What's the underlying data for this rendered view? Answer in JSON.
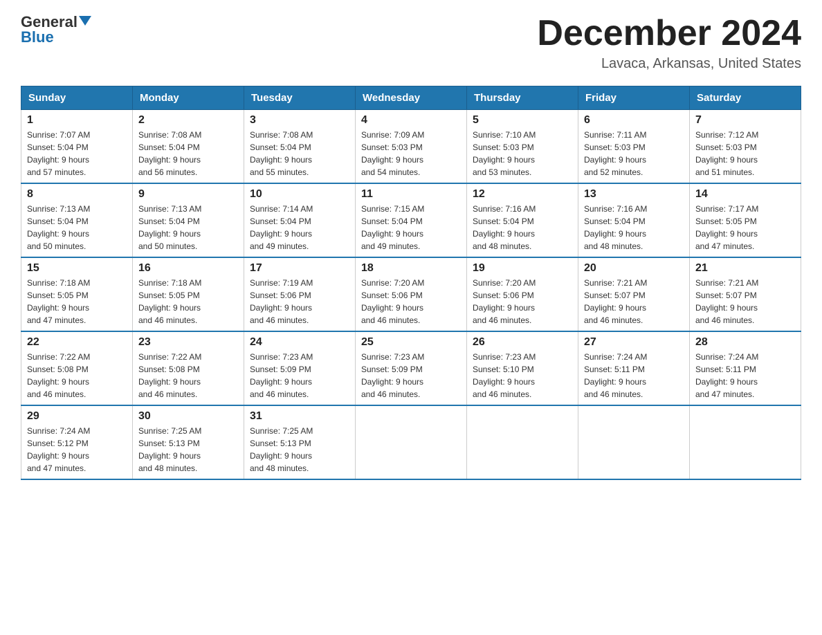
{
  "logo": {
    "name_part1": "General",
    "name_part2": "Blue"
  },
  "header": {
    "title": "December 2024",
    "subtitle": "Lavaca, Arkansas, United States"
  },
  "days_of_week": [
    "Sunday",
    "Monday",
    "Tuesday",
    "Wednesday",
    "Thursday",
    "Friday",
    "Saturday"
  ],
  "weeks": [
    [
      {
        "day": "1",
        "sunrise": "7:07 AM",
        "sunset": "5:04 PM",
        "daylight": "9 hours and 57 minutes."
      },
      {
        "day": "2",
        "sunrise": "7:08 AM",
        "sunset": "5:04 PM",
        "daylight": "9 hours and 56 minutes."
      },
      {
        "day": "3",
        "sunrise": "7:08 AM",
        "sunset": "5:04 PM",
        "daylight": "9 hours and 55 minutes."
      },
      {
        "day": "4",
        "sunrise": "7:09 AM",
        "sunset": "5:03 PM",
        "daylight": "9 hours and 54 minutes."
      },
      {
        "day": "5",
        "sunrise": "7:10 AM",
        "sunset": "5:03 PM",
        "daylight": "9 hours and 53 minutes."
      },
      {
        "day": "6",
        "sunrise": "7:11 AM",
        "sunset": "5:03 PM",
        "daylight": "9 hours and 52 minutes."
      },
      {
        "day": "7",
        "sunrise": "7:12 AM",
        "sunset": "5:03 PM",
        "daylight": "9 hours and 51 minutes."
      }
    ],
    [
      {
        "day": "8",
        "sunrise": "7:13 AM",
        "sunset": "5:04 PM",
        "daylight": "9 hours and 50 minutes."
      },
      {
        "day": "9",
        "sunrise": "7:13 AM",
        "sunset": "5:04 PM",
        "daylight": "9 hours and 50 minutes."
      },
      {
        "day": "10",
        "sunrise": "7:14 AM",
        "sunset": "5:04 PM",
        "daylight": "9 hours and 49 minutes."
      },
      {
        "day": "11",
        "sunrise": "7:15 AM",
        "sunset": "5:04 PM",
        "daylight": "9 hours and 49 minutes."
      },
      {
        "day": "12",
        "sunrise": "7:16 AM",
        "sunset": "5:04 PM",
        "daylight": "9 hours and 48 minutes."
      },
      {
        "day": "13",
        "sunrise": "7:16 AM",
        "sunset": "5:04 PM",
        "daylight": "9 hours and 48 minutes."
      },
      {
        "day": "14",
        "sunrise": "7:17 AM",
        "sunset": "5:05 PM",
        "daylight": "9 hours and 47 minutes."
      }
    ],
    [
      {
        "day": "15",
        "sunrise": "7:18 AM",
        "sunset": "5:05 PM",
        "daylight": "9 hours and 47 minutes."
      },
      {
        "day": "16",
        "sunrise": "7:18 AM",
        "sunset": "5:05 PM",
        "daylight": "9 hours and 46 minutes."
      },
      {
        "day": "17",
        "sunrise": "7:19 AM",
        "sunset": "5:06 PM",
        "daylight": "9 hours and 46 minutes."
      },
      {
        "day": "18",
        "sunrise": "7:20 AM",
        "sunset": "5:06 PM",
        "daylight": "9 hours and 46 minutes."
      },
      {
        "day": "19",
        "sunrise": "7:20 AM",
        "sunset": "5:06 PM",
        "daylight": "9 hours and 46 minutes."
      },
      {
        "day": "20",
        "sunrise": "7:21 AM",
        "sunset": "5:07 PM",
        "daylight": "9 hours and 46 minutes."
      },
      {
        "day": "21",
        "sunrise": "7:21 AM",
        "sunset": "5:07 PM",
        "daylight": "9 hours and 46 minutes."
      }
    ],
    [
      {
        "day": "22",
        "sunrise": "7:22 AM",
        "sunset": "5:08 PM",
        "daylight": "9 hours and 46 minutes."
      },
      {
        "day": "23",
        "sunrise": "7:22 AM",
        "sunset": "5:08 PM",
        "daylight": "9 hours and 46 minutes."
      },
      {
        "day": "24",
        "sunrise": "7:23 AM",
        "sunset": "5:09 PM",
        "daylight": "9 hours and 46 minutes."
      },
      {
        "day": "25",
        "sunrise": "7:23 AM",
        "sunset": "5:09 PM",
        "daylight": "9 hours and 46 minutes."
      },
      {
        "day": "26",
        "sunrise": "7:23 AM",
        "sunset": "5:10 PM",
        "daylight": "9 hours and 46 minutes."
      },
      {
        "day": "27",
        "sunrise": "7:24 AM",
        "sunset": "5:11 PM",
        "daylight": "9 hours and 46 minutes."
      },
      {
        "day": "28",
        "sunrise": "7:24 AM",
        "sunset": "5:11 PM",
        "daylight": "9 hours and 47 minutes."
      }
    ],
    [
      {
        "day": "29",
        "sunrise": "7:24 AM",
        "sunset": "5:12 PM",
        "daylight": "9 hours and 47 minutes."
      },
      {
        "day": "30",
        "sunrise": "7:25 AM",
        "sunset": "5:13 PM",
        "daylight": "9 hours and 48 minutes."
      },
      {
        "day": "31",
        "sunrise": "7:25 AM",
        "sunset": "5:13 PM",
        "daylight": "9 hours and 48 minutes."
      },
      null,
      null,
      null,
      null
    ]
  ],
  "labels": {
    "sunrise": "Sunrise:",
    "sunset": "Sunset:",
    "daylight": "Daylight:"
  }
}
